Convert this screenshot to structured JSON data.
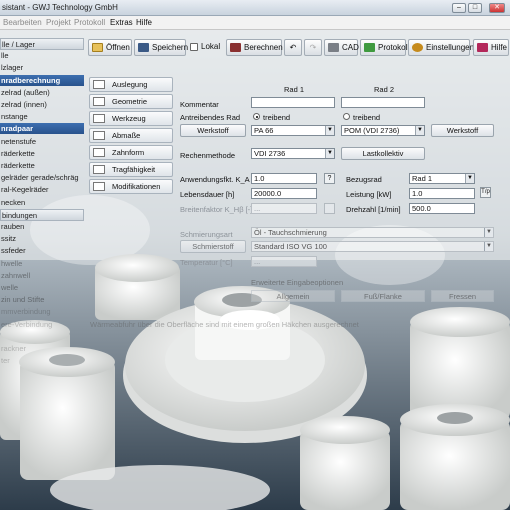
{
  "window": {
    "title": "sistant - GWJ Technology GmbH",
    "btn_min": "–",
    "btn_max": "□",
    "btn_close": "✕"
  },
  "menu": [
    {
      "label": "Bearbeiten",
      "enabled": false
    },
    {
      "label": "Projekt",
      "enabled": false
    },
    {
      "label": "Protokoll",
      "enabled": false
    },
    {
      "label": "Extras",
      "enabled": true
    },
    {
      "label": "Hilfe",
      "enabled": true
    }
  ],
  "toolbar": {
    "open": "Öffnen",
    "save": "Speichern",
    "local": "Lokal",
    "calc": "Berechnen",
    "undo": "↶",
    "redo": "↷",
    "cad": "CAD",
    "protocol": "Protokoll",
    "settings": "Einstellungen",
    "help": "Hilfe"
  },
  "sidebar": {
    "items": [
      {
        "label": "lle / Lager",
        "style": "hdr"
      },
      {
        "label": "lle",
        "style": ""
      },
      {
        "label": "lzlager",
        "style": ""
      },
      {
        "label": "nradberechnung",
        "style": "sel"
      },
      {
        "label": "zelrad (außen)",
        "style": ""
      },
      {
        "label": "zelrad (innen)",
        "style": ""
      },
      {
        "label": "nstange",
        "style": ""
      },
      {
        "label": "nradpaar",
        "style": "sel"
      },
      {
        "label": "netenstufe",
        "style": ""
      },
      {
        "label": "räderkette",
        "style": ""
      },
      {
        "label": "räderkette",
        "style": ""
      },
      {
        "label": "gelräder gerade/schräg",
        "style": ""
      },
      {
        "label": "ral-Kegelräder",
        "style": ""
      },
      {
        "label": "necken",
        "style": ""
      },
      {
        "label": "bindungen",
        "style": "hdr"
      },
      {
        "label": "rauben",
        "style": ""
      },
      {
        "label": "ssitz",
        "style": ""
      },
      {
        "label": "ssfeder",
        "style": ""
      },
      {
        "label": "hwelle",
        "style": "fade"
      },
      {
        "label": "zahnwell",
        "style": "fade"
      },
      {
        "label": "welle",
        "style": "fade"
      },
      {
        "label": "zin und Stifte",
        "style": "fade"
      },
      {
        "label": "mmverbindung",
        "style": "fade2"
      },
      {
        "label": "ere-Verbindung",
        "style": "fade2"
      },
      {
        "label": "",
        "style": "fade2"
      },
      {
        "label": "rackner",
        "style": "fade2"
      },
      {
        "label": "ter",
        "style": "fade2"
      }
    ]
  },
  "nav": [
    "Auslegung",
    "Geometrie",
    "Werkzeug",
    "Abmaße",
    "Zahnform",
    "Tragfähigkeit",
    "Modifikationen"
  ],
  "form": {
    "col1": "Rad 1",
    "col2": "Rad 2",
    "kommentar": "Kommentar",
    "kommentar1": "",
    "kommentar2": "",
    "antrieb": "Antreibendes Rad",
    "treibend": "treibend",
    "werkstoff_btn": "Werkstoff",
    "werkstoff1": "PA 66",
    "werkstoff2": "POM (VDI 2736)",
    "rechen": "Rechenmethode",
    "rechen_val": "VDI 2736",
    "lastkollektiv": "Lastkollektiv",
    "anw": "Anwendungsfkt. K_A [-]",
    "anw_val": "1.0",
    "anw_btn": "?",
    "bezug": "Bezugsrad",
    "bezug_val": "Rad 1",
    "lebens": "Lebensdauer [h]",
    "lebens_val": "20000.0",
    "leistung": "Leistung [kW]",
    "leistung_val": "1.0",
    "tpk": "T/p",
    "breiten": "Breitenfaktor K_Hβ [-]",
    "breiten_val": "...",
    "drehzahl": "Drehzahl [1/min]",
    "drehzahl_val": "500.0",
    "schmier": "Schmierungsart",
    "schmier_val": "Öl - Tauchschmierung",
    "schmierstoff": "Schmierstoff",
    "schmierstoff_val": "Standard ISO VG 100",
    "temp": "Temperatur [°C]",
    "temp_val": "...",
    "erweitert": "Erweiterte Eingabeoptionen",
    "allg": "Allgemein",
    "fuss": "Fuß/Flanke",
    "fressen": "Fressen",
    "note": "Wärmeabfuhr über die Oberfläche sind mit einem großen Häkchen ausgerechnet"
  }
}
